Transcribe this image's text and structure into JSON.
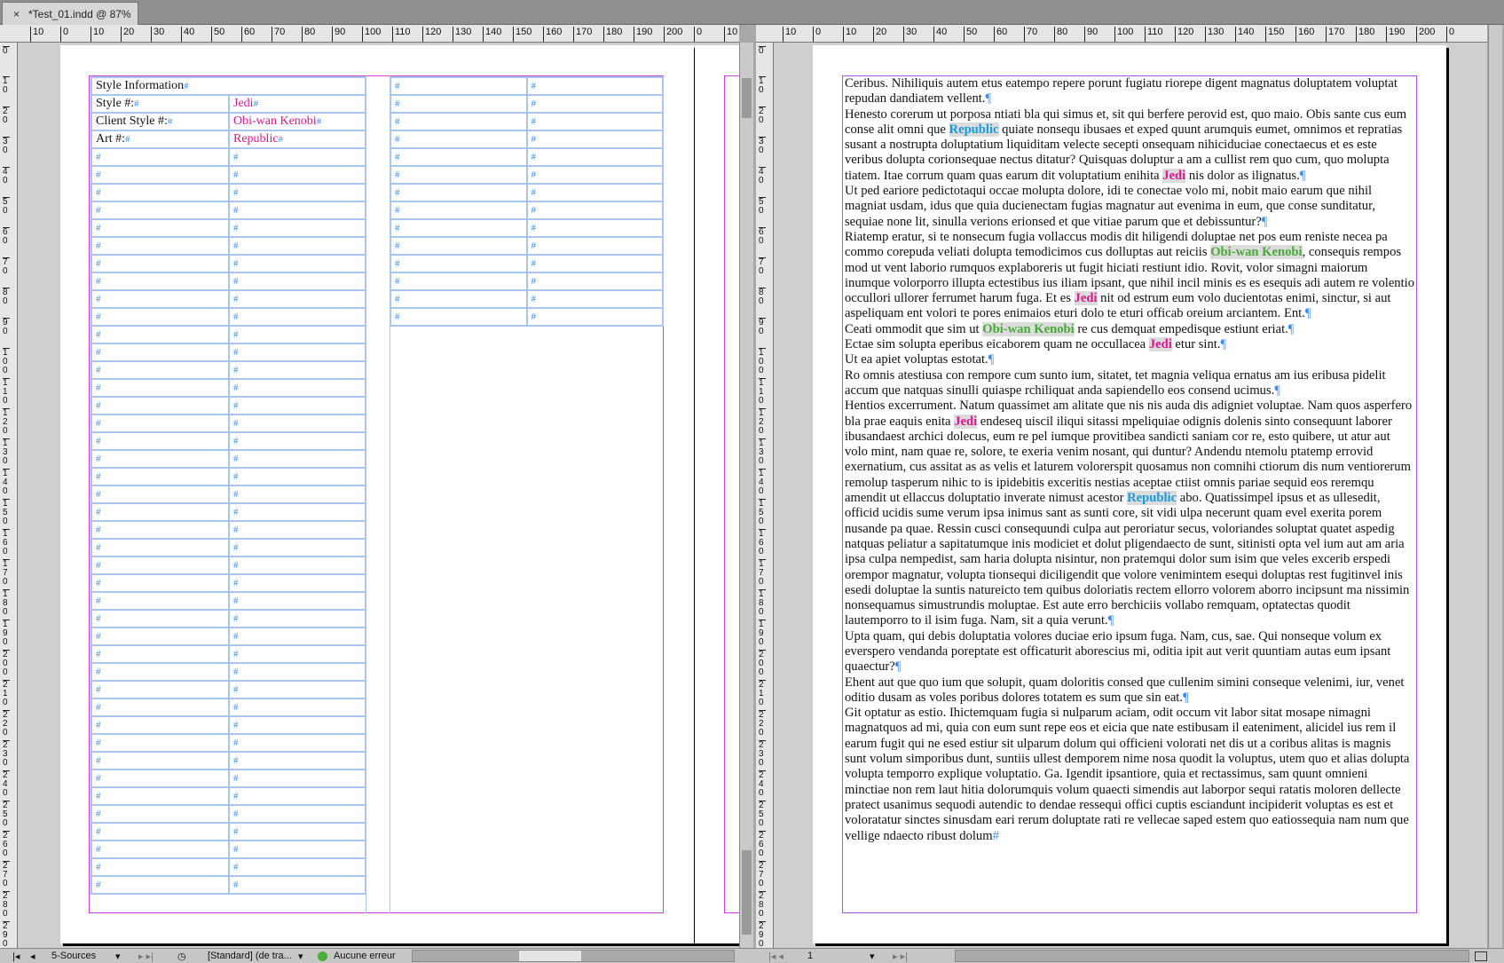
{
  "document": {
    "tab_title": "*Test_01.indd @ 87%",
    "close": "×"
  },
  "ruler_top_left": [
    "10",
    "0",
    "10",
    "20",
    "30",
    "40",
    "50",
    "60",
    "70",
    "80",
    "90",
    "100",
    "110",
    "120",
    "130",
    "140",
    "150",
    "160",
    "170",
    "180",
    "190",
    "200",
    "0",
    "10"
  ],
  "ruler_top_right": [
    "10",
    "0",
    "10",
    "20",
    "30",
    "40",
    "50",
    "60",
    "70",
    "80",
    "90",
    "100",
    "110",
    "120",
    "130",
    "140",
    "150",
    "160",
    "170",
    "180",
    "190",
    "200",
    "0"
  ],
  "ruler_side": [
    "0",
    "10",
    "20",
    "30",
    "40",
    "50",
    "60",
    "70",
    "80",
    "90",
    "100",
    "110",
    "120",
    "130",
    "140",
    "150",
    "160",
    "170",
    "180",
    "190",
    "200",
    "210",
    "220",
    "230",
    "240",
    "250",
    "260",
    "270",
    "280",
    "290"
  ],
  "table": {
    "header": "Style Information",
    "rows": [
      {
        "label": "Style #:",
        "value": "Jedi"
      },
      {
        "label": "Client Style #:",
        "value": "Obi-wan Kenobi"
      },
      {
        "label": "Art #:",
        "value": "Republic"
      }
    ],
    "cell_marker": "#"
  },
  "story": {
    "paragraphs": [
      [
        {
          "t": "Ceribus. Nihiliquis autem etus eatempo repere porunt fugiatu riorepe digent magnatus doluptatem voluptat repudan dandiatem vellent."
        }
      ],
      [
        {
          "t": "Henesto corerum ut porposa ntiati bla qui simus et, sit qui berfere perovid est, quo maio. Obis sante cus eum conse alit omni que "
        },
        {
          "t": "Republic",
          "s": "republic"
        },
        {
          "t": " quiate nonsequ ibusaes et exped quunt arumquis eumet, omnimos et repratias susant a nostrupta doluptatium liquiditam velecte secepti onsequam nihiciduciae conectaecus et es este veribus dolupta corionsequae nectus ditatur? Quisquas doluptur a am a cullist rem quo cum, quo molupta tiatem. Itae corrum quam quas earum dit voluptatium enihita "
        },
        {
          "t": "Jedi",
          "s": "jedi"
        },
        {
          "t": " nis dolor as ilignatus."
        }
      ],
      [
        {
          "t": "Ut ped eariore pedictotaqui occae molupta dolore, idi te conectae volo mi, nobit maio earum que nihil magniat usdam, idus que quia ducienectam fugias magnatur aut evenima in eum, que conse sunditatur, sequiae none lit, sinulla verions erionsed et que vitiae parum que et debissuntur?"
        }
      ],
      [
        {
          "t": "Riatemp eratur, si te nonsecum fugia vollaccus modis dit hiligendi doluptae net pos eum reniste necea pa commo corepuda veliati dolupta temodicimos cus dolluptas aut reiciis "
        },
        {
          "t": "Obi-wan Kenobi",
          "s": "kenobi"
        },
        {
          "t": ", consequis rempos mod ut vent laborio rumquos explaboreris ut fugit hiciati restiunt idio. Rovit, volor simagni maiorum inumque volorporro illupta ectestibus ius iliam ipsant, que nihil incil minis es es esequis adi autem re volentio occullori ullorer ferrumet harum fuga. Et es "
        },
        {
          "t": "Jedi",
          "s": "jedi"
        },
        {
          "t": " nit od estrum eum volo ducientotas enimi, sinctur, si aut aspeliquam ent volori te pores enimaios eturi dolo te eturi officab oreium arciantem. Ent."
        }
      ],
      [
        {
          "t": "Ceati ommodit que sim ut "
        },
        {
          "t": "Obi-wan Kenobi",
          "s": "kenobi"
        },
        {
          "t": " re cus demquat empedisque estiunt eriat."
        }
      ],
      [
        {
          "t": "Ectae sim solupta eperibus eicaborem quam ne occullacea "
        },
        {
          "t": "Jedi",
          "s": "jedi"
        },
        {
          "t": " etur sint."
        }
      ],
      [
        {
          "t": "Ut ea apiet voluptas estotat."
        }
      ],
      [
        {
          "t": "Ro omnis atestiusa con rempore cum sunto ium, sitatet, tet magnia veliqua ernatus am ius eribusa pidelit accum que natquas sinulli quiaspe rchiliquat anda sapiendello eos consend ucimus."
        }
      ],
      [
        {
          "t": "Hentios excerrument. Natum quassimet am alitate que nis nis auda dis adigniet voluptae. Nam quos asperfero bla prae eaquis enita "
        },
        {
          "t": "Jedi",
          "s": "jedi"
        },
        {
          "t": " endeseq uiscil iliqui sitassi mpeliquiae odignis dolenis sinto consequunt laborer ibusandaest archici dolecus, eum re pel iumque provitibea sandicti saniam cor re, esto quibere, ut atur aut volo mint, nam quae re, solore, te exeria venim nosant, qui duntur? Andendu ntemolu ptatemp errovid exernatium, cus assitat as as velis et laturem volorerspit quosamus non comnihi ctiorum dis num ventiorerum remolup tasperum nihic to is ipidebitis exceritis nestias aceptae ctiist omnis pariae sequid eos reremqu amendit ut ellaccus doluptatio inverate nimust acestor "
        },
        {
          "t": "Republic",
          "s": "republic"
        },
        {
          "t": " abo. Quatissimpel ipsus et as ullesedit, officid ucidis sume verum ipsa inimus sant as sunti core, sit vidi ulpa necerunt quam evel exerita porem nusande pa quae. Ressin cusci consequundi culpa aut peroriatur secus, voloriandes soluptat quatet aspedig natquas peliatur a sapitatumque inis modiciet et dolut pligendaecto de sunt, sitinisti opta vel ium aut am aria ipsa culpa nempedist, sam haria dolupta nisintur, non pratemqui dolor sum isim que veles excerib erspedi orempor magnatur, volupta tionsequi diciligendit que volore venimintem esequi doluptas rest fugitinvel inis esedi doluptae la suntis natureicto tem quibus doloriatis rectem ellorro volorem aborro incipsunt ma nissimin nonsequamus simustrundis moluptae. Est aute erro berchiciis vollabo remquam, optatectas quodit lautemporro to il isim fuga. Nam, sit a quia verunt."
        }
      ],
      [
        {
          "t": "Upta quam, qui debis doluptatia volores duciae erio ipsum fuga. Nam, cus, sae. Qui nonseque volum ex everspero vendanda poreptate est officaturit aborescius mi, oditia ipit aut verit quuntiam autas eum ipsant quaectur?"
        }
      ],
      [
        {
          "t": "Ehent aut que quo ium que solupit, quam doloritis consed que cullenim simini conseque velenimi, iur, venet oditio dusam as voles poribus dolores totatem es sum que sin eat."
        }
      ],
      [
        {
          "t": "Git optatur as estio. Ihictemquam fugia si nulparum aciam, odit occum vit labor sitat mosape nimagni magnatquos ad mi, quia con eum sunt repe eos et eicia que nate estibusam il eateniment, alicidel ius rem il earum fugit qui ne esed estiur sit ulparum dolum qui officieni volorati net dis ut a coribus alitas is magnis sunt volum simporibus dunt, suntiis ullest demporem nime nosa quodit la voluptus, utem quo et alias dolupta volupta temporro explique voluptatio. Ga. Igendit ipsantiore, quia et rectassimus, sam quunt omnieni minctiae non rem laut hitia dolorumquis volum quaecti simendis aut laborpor sequi ratatis moloren dellecte pratect usanimus sequodi autendic to dendae ressequi offici cuptis esciandunt incipiderit voluptas es est et voloratatur sinctes sinusdam eari rerum doluptate rati re vellecae saped estem quo eatiossequia nam num que vellige ndaecto ribust dolum"
        }
      ]
    ],
    "pilcrow": "¶",
    "end_marker": "#"
  },
  "status_left": {
    "page": "5-Sources",
    "preflight_profile": "[Standard] (de tra...",
    "errors": "Aucune erreur"
  },
  "status_right": {
    "page": "1"
  },
  "colors": {
    "jedi": "#e0158c",
    "republic": "#1a9ad8",
    "kenobi": "#49a83a",
    "frame": "#d23be0",
    "table_stroke": "#a9c6ee"
  }
}
